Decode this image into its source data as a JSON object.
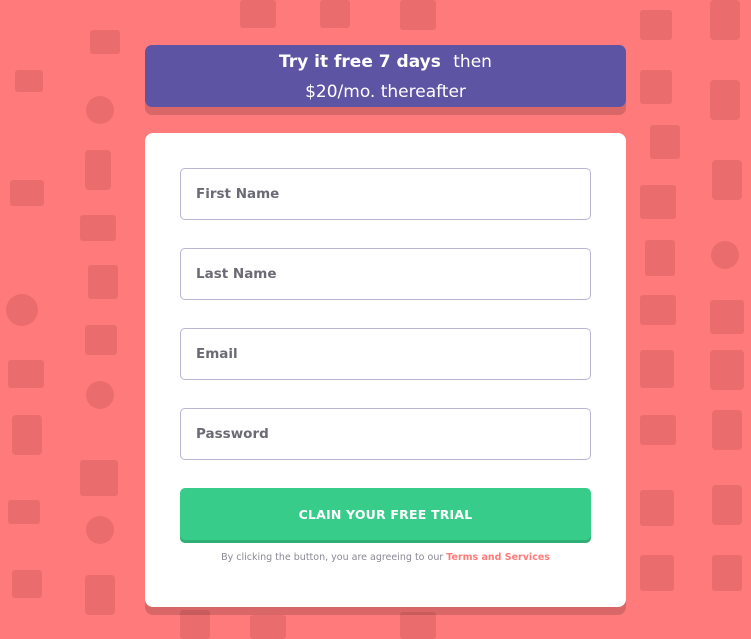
{
  "promo": {
    "bold": "Try it free 7 days",
    "light": "then",
    "line2": "$20/mo. thereafter"
  },
  "form": {
    "first_name_placeholder": "First Name",
    "last_name_placeholder": "Last Name",
    "email_placeholder": "Email",
    "password_placeholder": "Password",
    "submit_label": "CLAIN YOUR FREE TRIAL"
  },
  "terms": {
    "text": "By clicking the button, you are agreeing to our",
    "link": "Terms and Services"
  },
  "colors": {
    "background": "#ff7a7a",
    "promo": "#5e54a4",
    "button": "#38cc8b"
  }
}
